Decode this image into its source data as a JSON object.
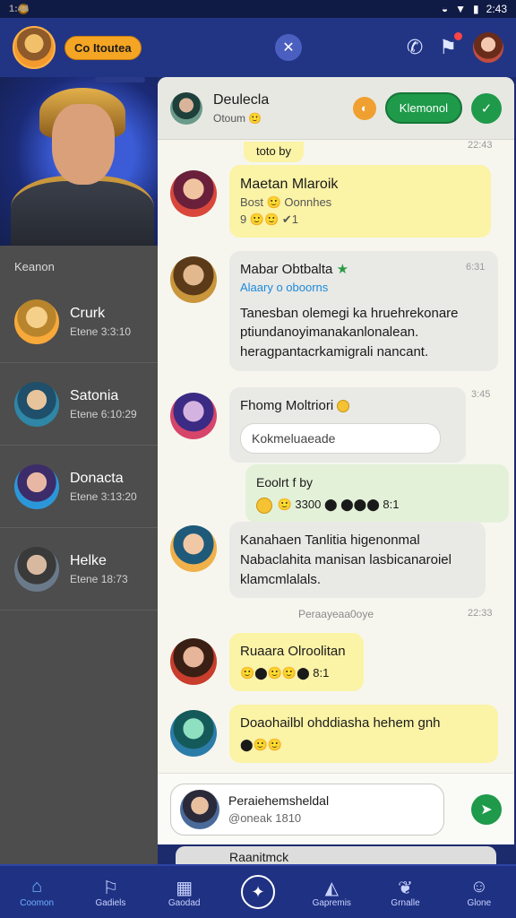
{
  "status_bar": {
    "time": "1:44",
    "right_text": "2:43"
  },
  "app_bar": {
    "status_pill": "Co Itoutea",
    "center_icon": "close-icon"
  },
  "sidebar": {
    "section_label": "Keanon",
    "items": [
      {
        "name": "Crurk",
        "time": "Etene 3:3:10"
      },
      {
        "name": "Satonia",
        "time": "Etene 6:10:29"
      },
      {
        "name": "Donacta",
        "time": "Etene 3:13:20"
      },
      {
        "name": "Helke",
        "time": "Etene 18:73"
      }
    ]
  },
  "chat_header": {
    "name": "Deulecla",
    "status": "Otoum 🙂",
    "action_button": "Klemonol"
  },
  "messages": [
    {
      "name": "Maetan Mlaroik",
      "line2": "Bost 🙂 Oonnhes",
      "line3": "9 🙂🙂 ✔1",
      "time": "22:43"
    },
    {
      "name": "Mabar Obtbalta",
      "tag": "Alaary o oboorns",
      "body": "Tanesban olemegi ka hruehrekonare ptiundanoyimanakanlonalean. heragpantacrkamigrali nancant.",
      "time": "6:31"
    },
    {
      "name": "Fhomg Moltriori",
      "reply": "Kokmeluaeade",
      "time": "3:45"
    },
    {
      "line1": "Eoolrt f by",
      "line2": "🙂 3300 ⬤ ⬤⬤⬤ 8:1"
    },
    {
      "name": "Kanahaen Tanlitia",
      "body": "Kanahaen Tanlitia higenonmal Nabaclahita manisan lasbicanaroiel klamcmlalals."
    },
    {
      "name": "Ruaara Olroolitan",
      "reactions": "🙂⬤🙂🙂⬤ 8:1"
    },
    {
      "name": "Doaohailbl ohddiasha hehem gnh",
      "reactions": "⬤🙂🙂"
    }
  ],
  "top_fragment": "toto by",
  "top_fragment_time": "22:43",
  "divider": "Peraayeaa0oye",
  "divider_time": "22:33",
  "composer": {
    "name": "Peraiehemsheldal",
    "placeholder": "@oneak 1810"
  },
  "peek_text": "Raanitmck",
  "bottom_nav": [
    {
      "label": "Coomon",
      "icon": "home-icon"
    },
    {
      "label": "Gadiels",
      "icon": "flag-icon"
    },
    {
      "label": "Gaodad",
      "icon": "calendar-icon"
    },
    {
      "label": "",
      "icon": "compass-icon"
    },
    {
      "label": "Gapremis",
      "icon": "chart-icon"
    },
    {
      "label": "Grnalle",
      "icon": "leaf-icon"
    },
    {
      "label": "Glone",
      "icon": "person-icon"
    }
  ]
}
